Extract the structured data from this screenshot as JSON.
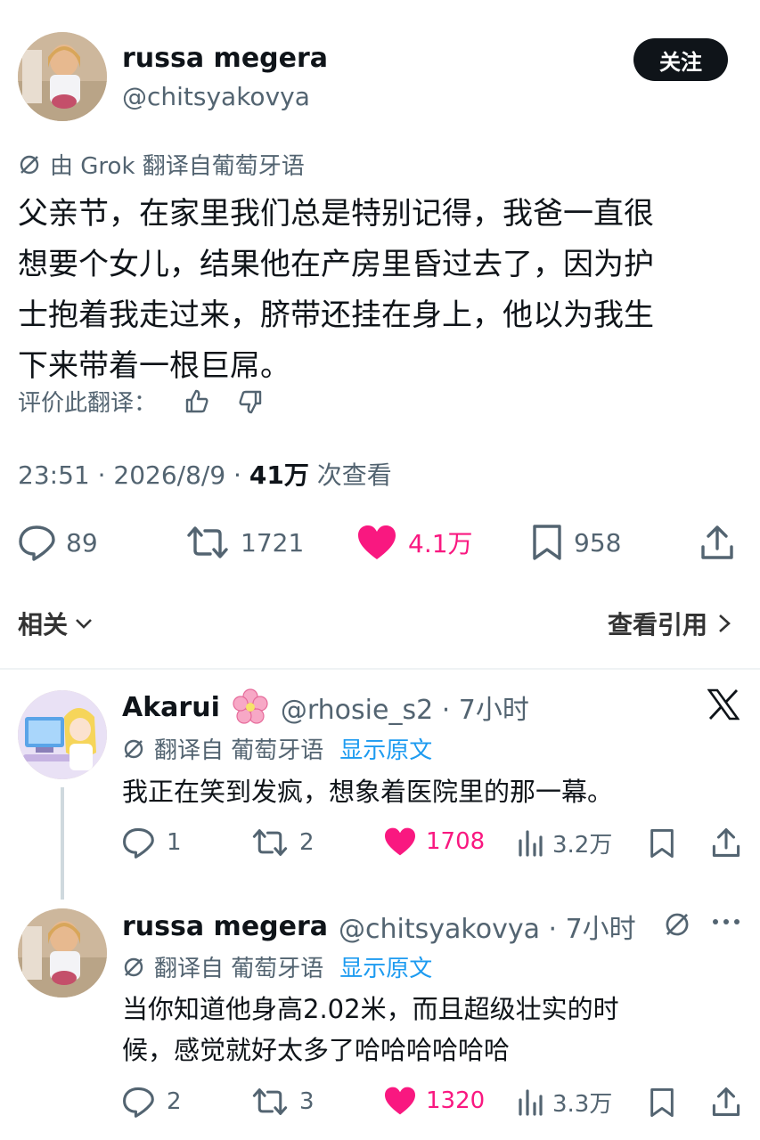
{
  "main_post": {
    "author_name": "russa megera",
    "author_handle": "@chitsyakovya",
    "follow_label": "关注",
    "translation_note": "由 Grok 翻译自葡萄牙语",
    "text_lines": [
      "父亲节，在家里我们总是特别记得，我爸一直很",
      "想要个女儿，结果他在产房里昏过去了，因为护",
      "士抱着我走过来，脐带还挂在身上，他以为我生",
      "下来带着一根巨屌。"
    ],
    "rate_label": "评价此翻译：",
    "time": "23:51 · 2026/8/9 · ",
    "views_count": "41万",
    "views_label": " 次查看",
    "stats": {
      "replies": "89",
      "retweets": "1721",
      "likes": "4.1万",
      "bookmarks": "958"
    }
  },
  "related": {
    "label": "相关",
    "quotes_label": "查看引用"
  },
  "replies": [
    {
      "author_name": "Akarui",
      "author_handle": "@rhosie_s2 · 7小时",
      "translation_note": "翻译自 葡萄牙语",
      "show_original": "显示原文",
      "text_lines": [
        "我正在笑到发疯，想象着医院里的那一幕。"
      ],
      "stats": {
        "replies": "1",
        "retweets": "2",
        "likes": "1708",
        "views": "3.2万"
      }
    },
    {
      "author_name": "russa megera",
      "author_handle": "@chitsyakovya · 7小时",
      "translation_note": "翻译自 葡萄牙语",
      "show_original": "显示原文",
      "text_lines": [
        "当你知道他身高2.02米，而且超级壮实的时",
        "候，感觉就好太多了哈哈哈哈哈哈"
      ],
      "stats": {
        "replies": "2",
        "retweets": "3",
        "likes": "1320",
        "views": "3.3万"
      }
    }
  ],
  "colors": {
    "like": "#f91880",
    "link": "#1d9bf0",
    "muted": "#536471",
    "text": "#0f1419"
  }
}
